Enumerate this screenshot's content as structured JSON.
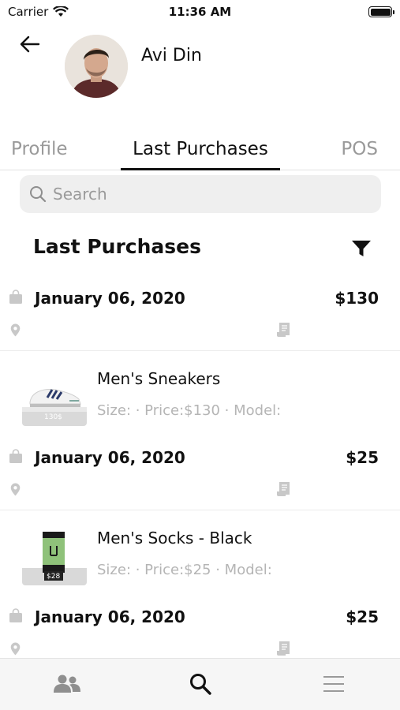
{
  "status_bar": {
    "carrier": "Carrier",
    "time": "11:36 AM"
  },
  "header": {
    "user_name": "Avi Din"
  },
  "tabs": [
    {
      "label": "Profile",
      "active": false
    },
    {
      "label": "Last Purchases",
      "active": true
    },
    {
      "label": "POS",
      "active": false
    }
  ],
  "search": {
    "placeholder": "Search",
    "value": ""
  },
  "section": {
    "title": "Last Purchases"
  },
  "purchases": [
    {
      "date": "January 06, 2020",
      "amount": "$130",
      "item": {
        "name": "Men's Sneakers",
        "meta": "Size: · Price:$130 · Model:",
        "tag": "130$"
      }
    },
    {
      "date": "January 06, 2020",
      "amount": "$25",
      "item": {
        "name": "Men's Socks - Black",
        "meta": "Size: · Price:$25 · Model:",
        "tag": "$28"
      }
    },
    {
      "date": "January 06, 2020",
      "amount": "$25"
    }
  ],
  "icons": {
    "back": "arrow-left-icon",
    "search": "search-icon",
    "filter": "filter-icon",
    "bag": "shopping-bag-icon",
    "pin": "location-pin-icon",
    "receipt": "receipt-icon",
    "nav_people": "people-icon",
    "nav_search": "search-icon",
    "nav_menu": "menu-icon"
  },
  "colors": {
    "accent": "#111111",
    "muted_text": "#9a9a9a",
    "meta_text": "#b5b5b5",
    "icon_gray": "#c8c8c8"
  }
}
